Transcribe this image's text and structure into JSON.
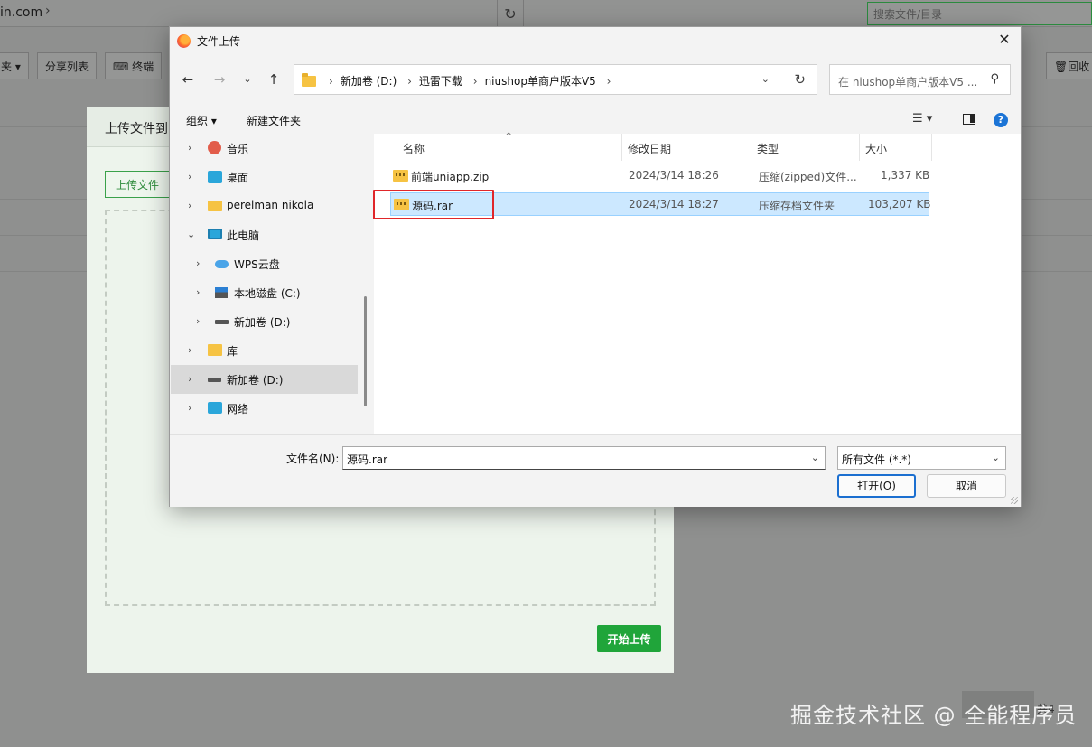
{
  "background": {
    "url_fragment": "in.com",
    "search_placeholder": "搜索文件/目录",
    "toolbar": {
      "btn_folder_partial": "夹",
      "btn_share_list": "分享列表",
      "btn_terminal": "终端",
      "btn_recycle": "回收"
    },
    "upload_modal": {
      "title": "上传文件到",
      "upload_file_button": "上传文件",
      "start_upload_button": "开始上传"
    },
    "watermark": "掘金技术社区 @ 全能程序员",
    "bottom_right": "共4"
  },
  "dialog": {
    "title": "文件上传",
    "breadcrumbs": [
      "新加卷 (D:)",
      "迅雷下载",
      "niushop单商户版本V5"
    ],
    "search_placeholder": "在 niushop单商户版本V5 ...",
    "commands": {
      "organize": "组织 ▾",
      "new_folder": "新建文件夹"
    },
    "nav_items": [
      {
        "label": "音乐",
        "icon": "music-icon"
      },
      {
        "label": "桌面",
        "icon": "desktop-icon"
      },
      {
        "label": "perelman nikola",
        "icon": "folder-icon"
      },
      {
        "label": "此电脑",
        "icon": "computer-icon"
      },
      {
        "label": "WPS云盘",
        "icon": "cloud-icon"
      },
      {
        "label": "本地磁盘 (C:)",
        "icon": "disk-icon"
      },
      {
        "label": "新加卷 (D:)",
        "icon": "drive-icon"
      },
      {
        "label": "库",
        "icon": "library-icon"
      },
      {
        "label": "新加卷 (D:)",
        "icon": "drive-icon"
      },
      {
        "label": "网络",
        "icon": "network-icon"
      }
    ],
    "columns": {
      "name": "名称",
      "modified": "修改日期",
      "type": "类型",
      "size": "大小"
    },
    "files": [
      {
        "name": "前端uniapp.zip",
        "modified": "2024/3/14 18:26",
        "type": "压缩(zipped)文件...",
        "size": "1,337 KB",
        "selected": false
      },
      {
        "name": "源码.rar",
        "modified": "2024/3/14 18:27",
        "type": "压缩存档文件夹",
        "size": "103,207 KB",
        "selected": true
      }
    ],
    "filename_label": "文件名(N):",
    "filename_value": "源码.rar",
    "filetype_value": "所有文件 (*.*)",
    "open_button": "打开(O)",
    "cancel_button": "取消"
  }
}
